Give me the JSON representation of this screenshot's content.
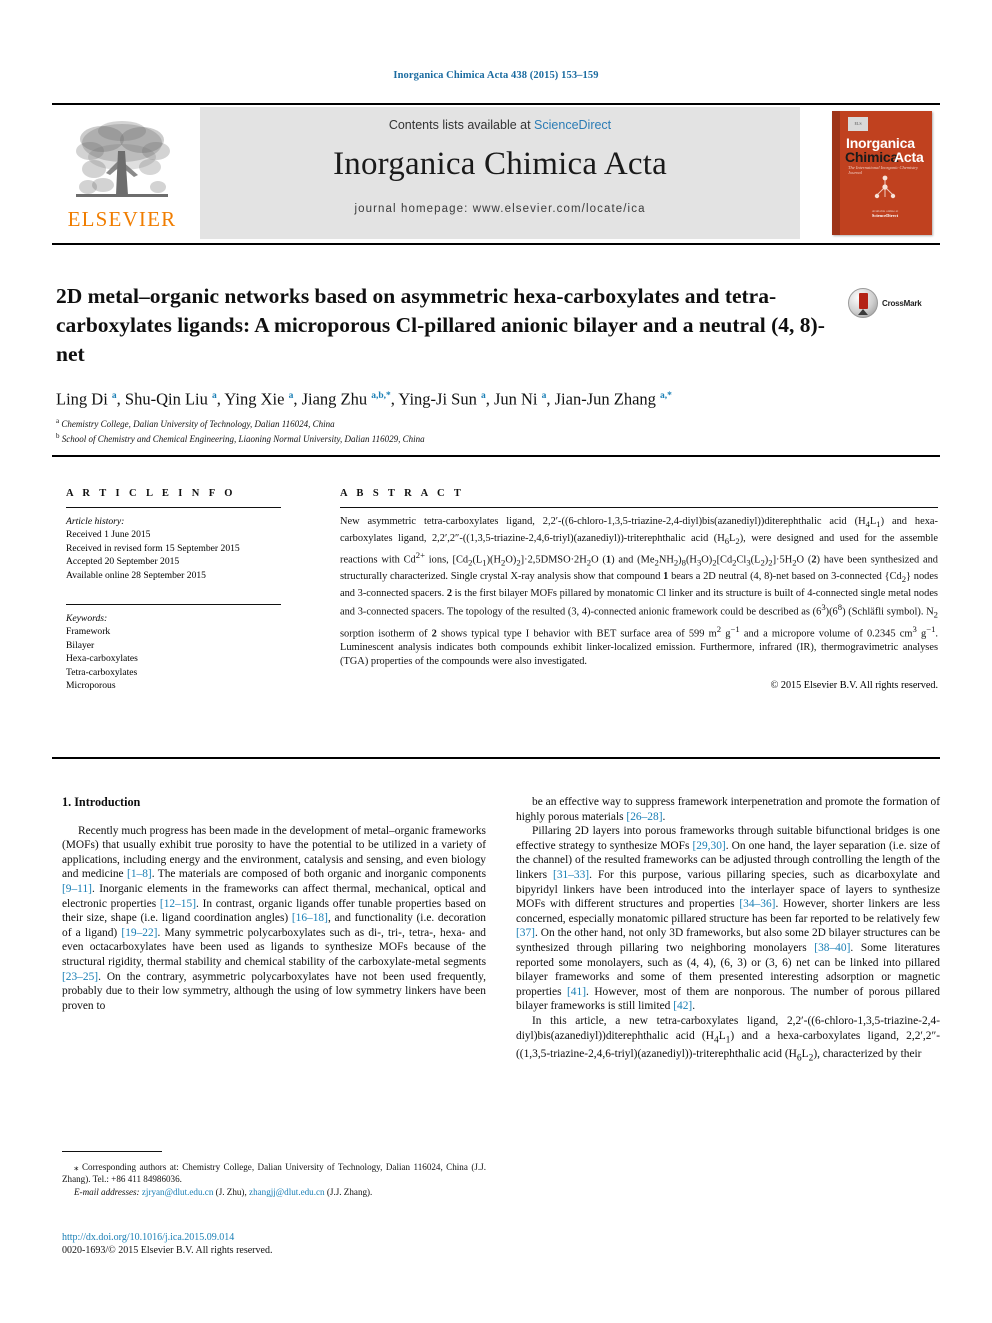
{
  "running_head": "Inorganica Chimica Acta 438 (2015) 153–159",
  "masthead": {
    "publisher_logo_text": "ELSEVIER",
    "contents_prefix": "Contents lists available at ",
    "contents_link": "ScienceDirect",
    "journal_title": "Inorganica Chimica Acta",
    "journal_homepage": "journal homepage: www.elsevier.com/locate/ica",
    "cover": {
      "line1": "Inorganica",
      "line2": "Chimica",
      "line3": "Acta",
      "subtitle": "The International Inorganic Chemistry Journal",
      "footer_small": "Available online at",
      "footer_brand": "ScienceDirect"
    }
  },
  "article": {
    "title": "2D metal–organic networks based on asymmetric hexa-carboxylates and tetra-carboxylates ligands: A microporous Cl-pillared anionic bilayer and a neutral (4, 8)-net",
    "crossmark_label": "CrossMark",
    "authors_html": "Ling Di <sup>a</sup>, Shu-Qin Liu <sup>a</sup>, Ying Xie <sup>a</sup>, Jiang Zhu <sup>a,b,*</sup>, Ying-Ji Sun <sup>a</sup>, Jun Ni <sup>a</sup>, Jian-Jun Zhang <sup>a,*</sup>",
    "affiliations_html": "<sup>a</sup> Chemistry College, Dalian University of Technology, Dalian 116024, China<br><sup>b</sup> School of Chemistry and Chemical Engineering, Liaoning Normal University, Dalian 116029, China"
  },
  "article_info": {
    "heading": "A R T I C L E   I N F O",
    "history_label": "Article history:",
    "history": [
      "Received 1 June 2015",
      "Received in revised form 15 September 2015",
      "Accepted 20 September 2015",
      "Available online 28 September 2015"
    ],
    "keywords_label": "Keywords:",
    "keywords": [
      "Framework",
      "Bilayer",
      "Hexa-carboxylates",
      "Tetra-carboxylates",
      "Microporous"
    ]
  },
  "abstract": {
    "heading": "A B S T R A C T",
    "body_html": "New asymmetric tetra-carboxylates ligand, 2,2&prime;-((6-chloro-1,3,5-triazine-2,4-diyl)bis(azanediyl))diterephthalic acid (H<sub>4</sub>L<sub>1</sub>) and hexa-carboxylates ligand, 2,2&prime;,2&Prime;-((1,3,5-triazine-2,4,6-triyl)(azanediyl))-triterephthalic acid (H<sub>6</sub>L<sub>2</sub>), were designed and used for the assemble reactions with Cd<sup>2+</sup> ions, [Cd<sub>2</sub>(L<sub>1</sub>)(H<sub>2</sub>O)<sub>2</sub>]&middot;2,5DMSO&middot;2H<sub>2</sub>O (<b>1</b>) and (Me<sub>2</sub>NH<sub>2</sub>)<sub>8</sub>(H<sub>3</sub>O)<sub>2</sub>[Cd<sub>2</sub>Cl<sub>3</sub>(L<sub>2</sub>)<sub>2</sub>]&middot;5H<sub>2</sub>O (<b>2</b>) have been synthesized and structurally characterized. Single crystal X-ray analysis show that compound <b>1</b> bears a 2D neutral (4, 8)-net based on 3-connected {Cd<sub>2</sub>} nodes and 3-connected spacers. <b>2</b> is the first bilayer MOFs pillared by monatomic Cl linker and its structure is built of 4-connected single metal nodes and 3-connected spacers. The topology of the resulted (3, 4)-connected anionic framework could be described as (6<sup>3</sup>)(6<sup>8</sup>) (Schläfli symbol). N<sub>2</sub> sorption isotherm of <b>2</b> shows typical type I behavior with BET surface area of 599 m<sup>2</sup> g<sup>&minus;1</sup> and a micropore volume of 0.2345 cm<sup>3</sup> g<sup>&minus;1</sup>. Luminescent analysis indicates both compounds exhibit linker-localized emission. Furthermore, infrared (IR), thermogravimetric analyses (TGA) properties of the compounds were also investigated.",
    "copyright": "© 2015 Elsevier B.V. All rights reserved."
  },
  "body": {
    "section_heading": "1. Introduction",
    "left_paragraphs_html": [
      "Recently much progress has been made in the development of metal–organic frameworks (MOFs) that usually exhibit true porosity to have the potential to be utilized in a variety of applications, including energy and the environment, catalysis and sensing, and even biology and medicine <span class=\"ref\">[1–8]</span>. The materials are composed of both organic and inorganic components <span class=\"ref\">[9–11]</span>. Inorganic elements in the frameworks can affect thermal, mechanical, optical and electronic properties <span class=\"ref\">[12–15]</span>. In contrast, organic ligands offer tunable properties based on their size, shape (i.e. ligand coordination angles) <span class=\"ref\">[16–18]</span>, and functionality (i.e. decoration of a ligand) <span class=\"ref\">[19–22]</span>. Many symmetric polycarboxylates such as di-, tri-, tetra-, hexa- and even octacarboxylates have been used as ligands to synthesize MOFs because of the structural rigidity, thermal stability and chemical stability of the carboxylate-metal segments <span class=\"ref\">[23–25]</span>. On the contrary, asymmetric polycarboxylates have not been used frequently, probably due to their low symmetry, although the using of low symmetry linkers have been proven to"
    ],
    "right_paragraphs_html": [
      "be an effective way to suppress framework interpenetration and promote the formation of highly porous materials <span class=\"ref\">[26–28]</span>.",
      "Pillaring 2D layers into porous frameworks through suitable bifunctional bridges is one effective strategy to synthesize MOFs <span class=\"ref\">[29,30]</span>. On one hand, the layer separation (i.e. size of the channel) of the resulted frameworks can be adjusted through controlling the length of the linkers <span class=\"ref\">[31–33]</span>. For this purpose, various pillaring species, such as dicarboxylate and bipyridyl linkers have been introduced into the interlayer space of layers to synthesize MOFs with different structures and properties <span class=\"ref\">[34–36]</span>. However, shorter linkers are less concerned, especially monatomic pillared structure has been far reported to be relatively few <span class=\"ref\">[37]</span>. On the other hand, not only 3D frameworks, but also some 2D bilayer structures can be synthesized through pillaring two neighboring monolayers <span class=\"ref\">[38–40]</span>. Some literatures reported some monolayers, such as (4, 4), (6, 3) or (3, 6) net can be linked into pillared bilayer frameworks and some of them presented interesting adsorption or magnetic properties <span class=\"ref\">[41]</span>. However, most of them are nonporous. The number of porous pillared bilayer frameworks is still limited <span class=\"ref\">[42]</span>.",
      "In this article, a new tetra-carboxylates ligand, 2,2&prime;-((6-chloro-1,3,5-triazine-2,4-diyl)bis(azanediyl))diterephthalic acid (H<sub>4</sub>L<sub>1</sub>) and a hexa-carboxylates ligand, 2,2&prime;,2&Prime;-((1,3,5-triazine-2,4,6-triyl)(azanediyl))-triterephthalic acid (H<sub>6</sub>L<sub>2</sub>), characterized by their"
    ]
  },
  "footnotes": {
    "corresponding_html": "&#8270; Corresponding authors at: Chemistry College, Dalian University of Technology, Dalian 116024, China (J.J. Zhang). Tel.: +86 411 84986036.",
    "email_label": "E-mail addresses:",
    "email_1": "zjryan@dlut.edu.cn",
    "email_1_who": "(J. Zhu),",
    "email_2": "zhangjj@dlut.edu.cn",
    "email_2_who": "(J.J. Zhang).",
    "doi": "http://dx.doi.org/10.1016/j.ica.2015.09.014",
    "issn_line": "0020-1693/© 2015 Elsevier B.V. All rights reserved."
  }
}
